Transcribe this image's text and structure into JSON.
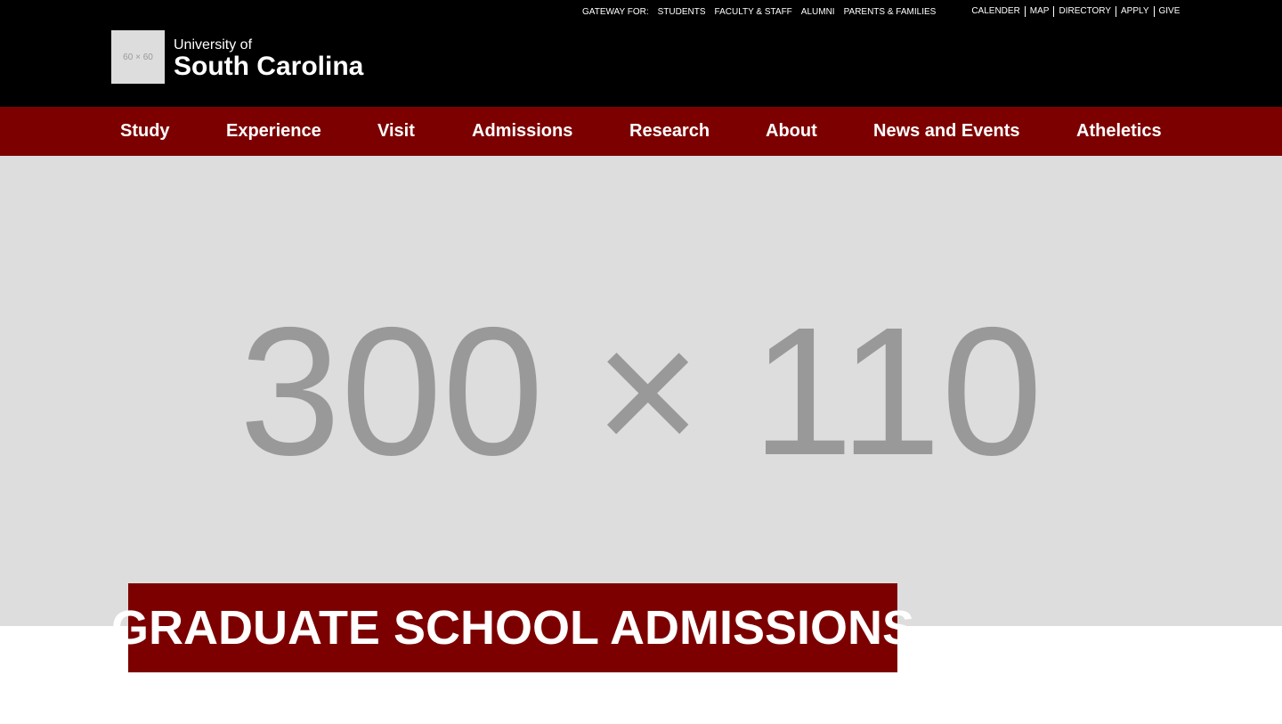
{
  "colors": {
    "topbar_bg": "#000000",
    "nav_bg": "#7d0000",
    "hero_bg": "#dddddd",
    "placeholder_text": "#999999",
    "text_light": "#ffffff"
  },
  "utility": {
    "gateway_label": "GATEWAY FOR:",
    "gateway_links": [
      "STUDENTS",
      "FACULTY & STAFF",
      "ALUMNI",
      "PARENTS & FAMILIES"
    ],
    "quick_links": [
      "CALENDER",
      "MAP",
      "DIRECTORY",
      "APPLY",
      "GIVE"
    ]
  },
  "brand": {
    "logo_placeholder": "60 × 60",
    "line1": "University of",
    "line2": "South Carolina"
  },
  "nav": {
    "items": [
      "Study",
      "Experience",
      "Visit",
      "Admissions",
      "Research",
      "About",
      "News and Events",
      "Atheletics"
    ]
  },
  "hero": {
    "placeholder": "300 × 110"
  },
  "banner": {
    "title": "GRADUATE SCHOOL ADMISSIONS"
  }
}
